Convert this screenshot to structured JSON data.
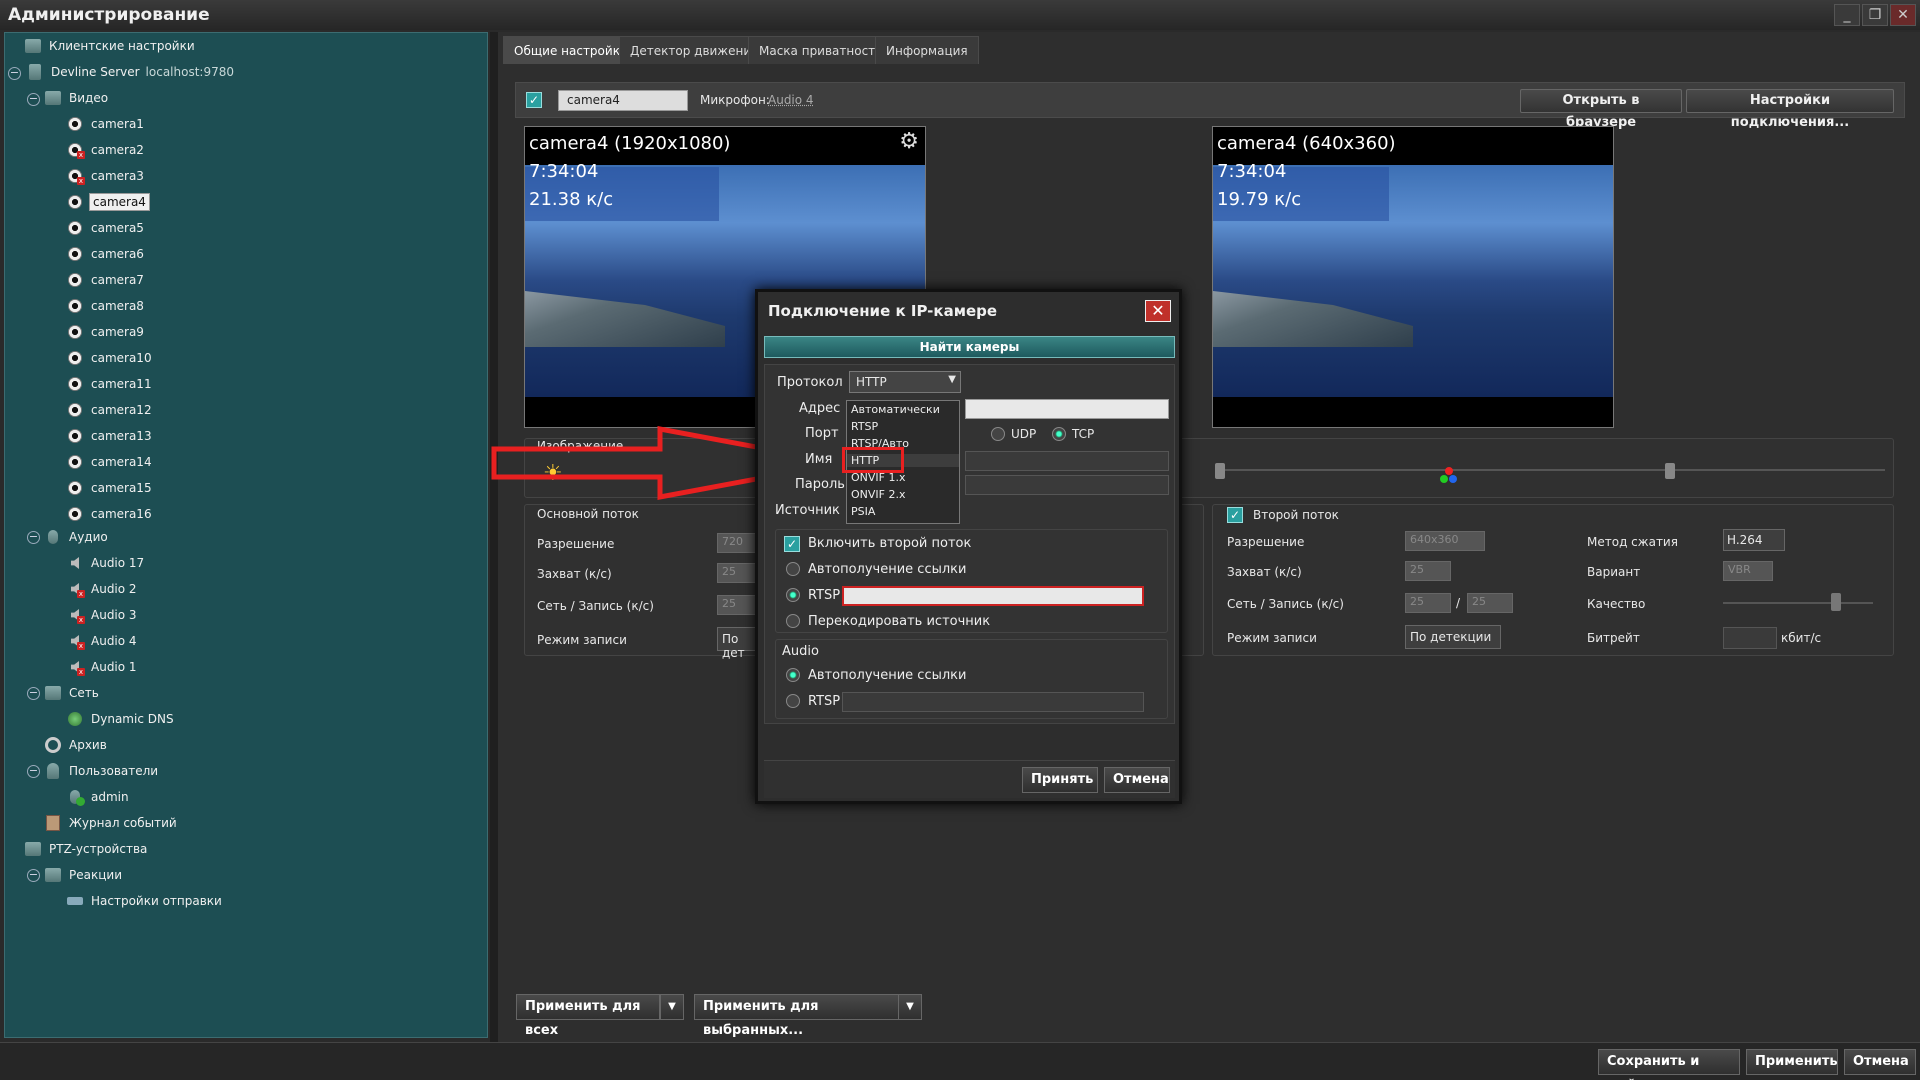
{
  "window": {
    "title": "Администрирование",
    "min": "_",
    "max": "❐",
    "close": "✕"
  },
  "tree": {
    "client": "Клиентские настройки",
    "server": "Devline Server",
    "server_addr": "localhost:9780",
    "video": "Видео",
    "cameras": [
      "camera1",
      "camera2",
      "camera3",
      "camera4",
      "camera5",
      "camera6",
      "camera7",
      "camera8",
      "camera9",
      "camera10",
      "camera11",
      "camera12",
      "camera13",
      "camera14",
      "camera15",
      "camera16"
    ],
    "audio": "Аудио",
    "audios": [
      "Audio 17",
      "Audio 2",
      "Audio 3",
      "Audio 4",
      "Audio 1"
    ],
    "net": "Сеть",
    "ddns": "Dynamic DNS",
    "archive": "Архив",
    "users": "Пользователи",
    "admin": "admin",
    "journal": "Журнал событий",
    "ptz": "PTZ-устройства",
    "reactions": "Реакции",
    "send": "Настройки отправки"
  },
  "tabs": [
    "Общие настройки",
    "Детектор движения",
    "Маска приватности",
    "Информация"
  ],
  "toolbar": {
    "camera_name": "camera4",
    "mic_label": "Микрофон:",
    "mic_value": "Audio 4",
    "open_browser": "Открыть в браузере",
    "conn_settings": "Настройки подключения..."
  },
  "preview1": {
    "title": "camera4 (1920x1080)",
    "time": "7:34:04",
    "fps": "21.38 к/с"
  },
  "preview2": {
    "title": "camera4 (640x360)",
    "time": "7:34:04",
    "fps": "19.79 к/с"
  },
  "image_label": "Изображение",
  "main_stream": {
    "title": "Основной поток",
    "res": "Разрешение",
    "res_v": "720",
    "cap": "Захват (к/с)",
    "cap_v": "25",
    "net": "Сеть / Запись (к/с)",
    "net_v": "25",
    "mode": "Режим записи",
    "mode_v": "По дет"
  },
  "second_stream": {
    "title": "Второй поток",
    "res": "Разрешение",
    "res_v": "640x360",
    "cap": "Захват (к/с)",
    "cap_v": "25",
    "net": "Сеть / Запись (к/с)",
    "net_v1": "25",
    "slash": "/",
    "net_v2": "25",
    "mode": "Режим записи",
    "mode_v": "По детекции",
    "codec": "Метод сжатия",
    "codec_v": "H.264",
    "variant": "Вариант",
    "variant_v": "VBR",
    "quality": "Качество",
    "bitrate": "Битрейт",
    "bitrate_unit": "кбит/с"
  },
  "dialog": {
    "title": "Подключение к IP-камере",
    "close": "✕",
    "find": "Найти камеры",
    "protocol": "Протокол",
    "protocol_v": "HTTP",
    "address": "Адрес",
    "port": "Порт",
    "name": "Имя",
    "password": "Пароль",
    "source": "Источник",
    "udp": "UDP",
    "tcp": "TCP",
    "options": [
      "Автоматически",
      "RTSP",
      "RTSP/Авто",
      "HTTP",
      "ONVIF 1.x",
      "ONVIF 2.x",
      "PSIA"
    ],
    "second": "Включить второй поток",
    "auto_link": "Автополучение ссылки",
    "rtsp": "RTSP",
    "recode": "Перекодировать источник",
    "audio": "Audio",
    "audio_auto": "Автополучение ссылки",
    "audio_rtsp": "RTSP",
    "accept": "Принять",
    "cancel": "Отмена"
  },
  "bottom": {
    "apply_all": "Применить для всех",
    "apply_sel": "Применить для выбранных...",
    "save_exit": "Сохранить и выйти",
    "apply": "Применить",
    "cancel": "Отмена"
  },
  "colors": {
    "tree_bg": "#1d4e53",
    "accent": "#2aa0a0",
    "highlight": "#e82020"
  }
}
